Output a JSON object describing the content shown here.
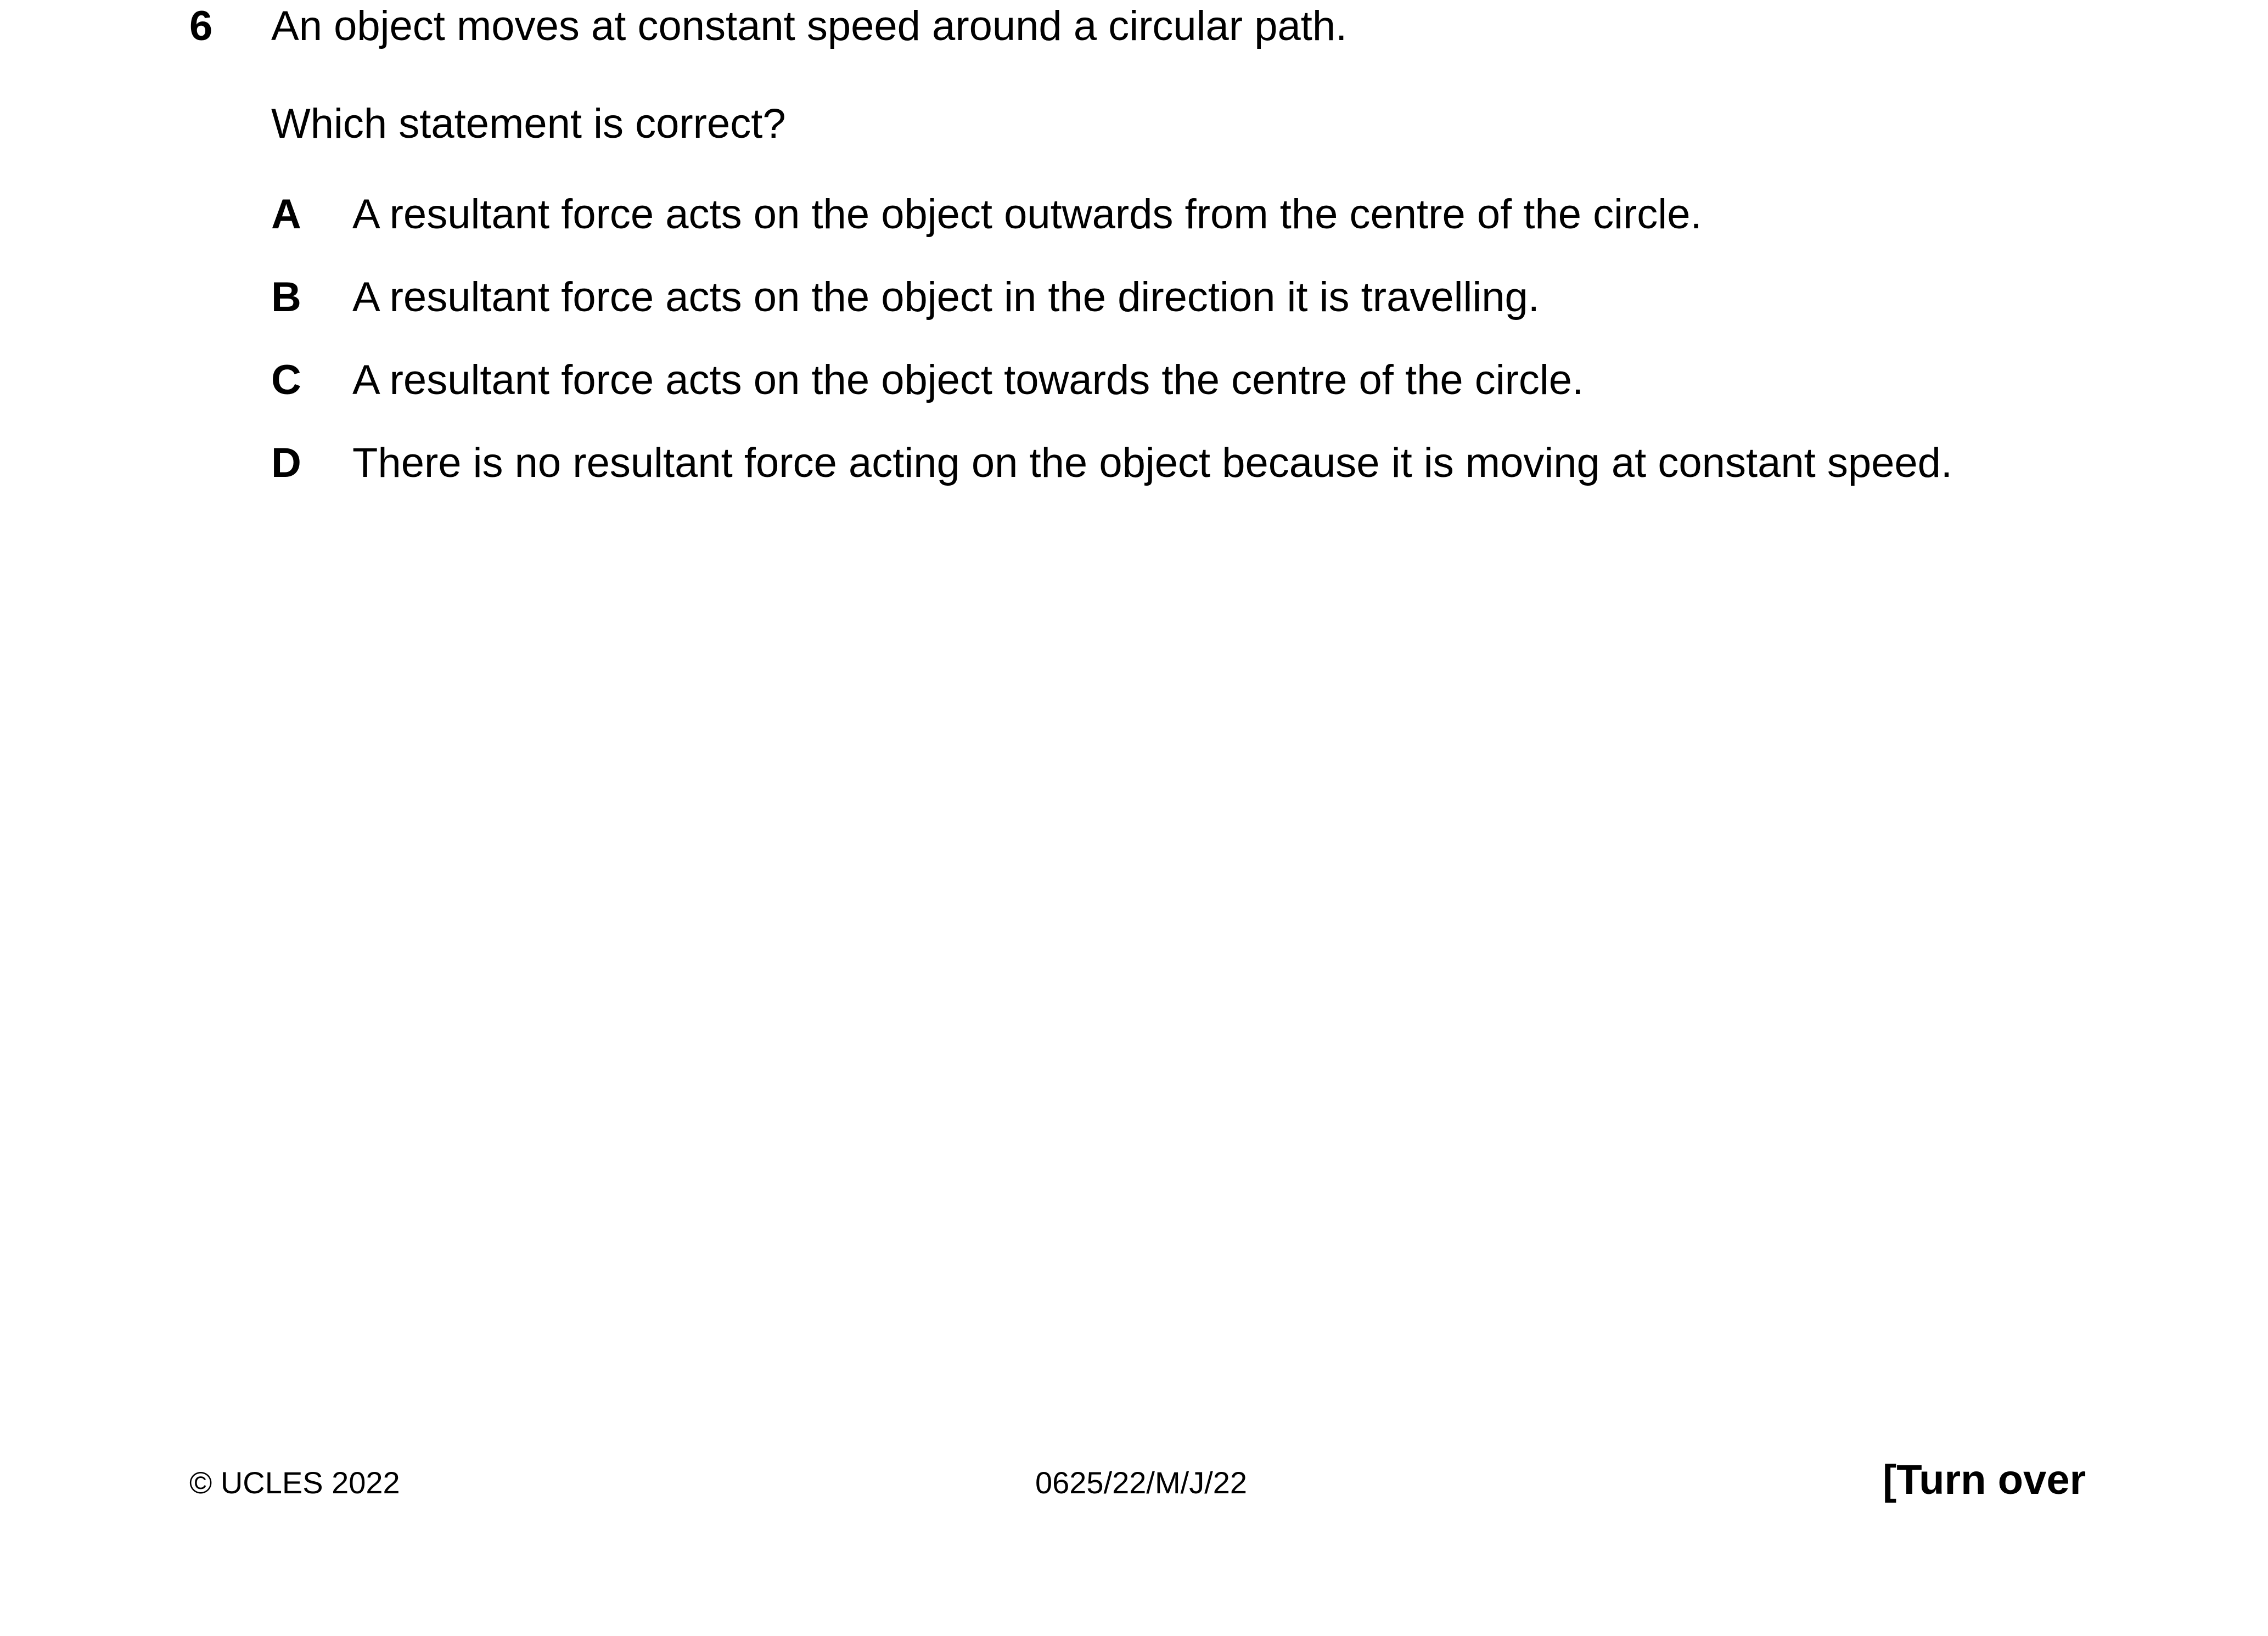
{
  "question": {
    "number": "6",
    "stem": "An object moves at constant speed around a circular path.",
    "prompt": "Which statement is correct?",
    "options": [
      {
        "letter": "A",
        "text": "A resultant force acts on the object outwards from the centre of the circle."
      },
      {
        "letter": "B",
        "text": "A resultant force acts on the object in the direction it is travelling."
      },
      {
        "letter": "C",
        "text": "A resultant force acts on the object towards the centre of the circle."
      },
      {
        "letter": "D",
        "text": "There is no resultant force acting on the object because it is moving at constant speed."
      }
    ]
  },
  "footer": {
    "copyright": "© UCLES 2022",
    "paper_code": "0625/22/M/J/22",
    "turn_over": "[Turn over"
  }
}
